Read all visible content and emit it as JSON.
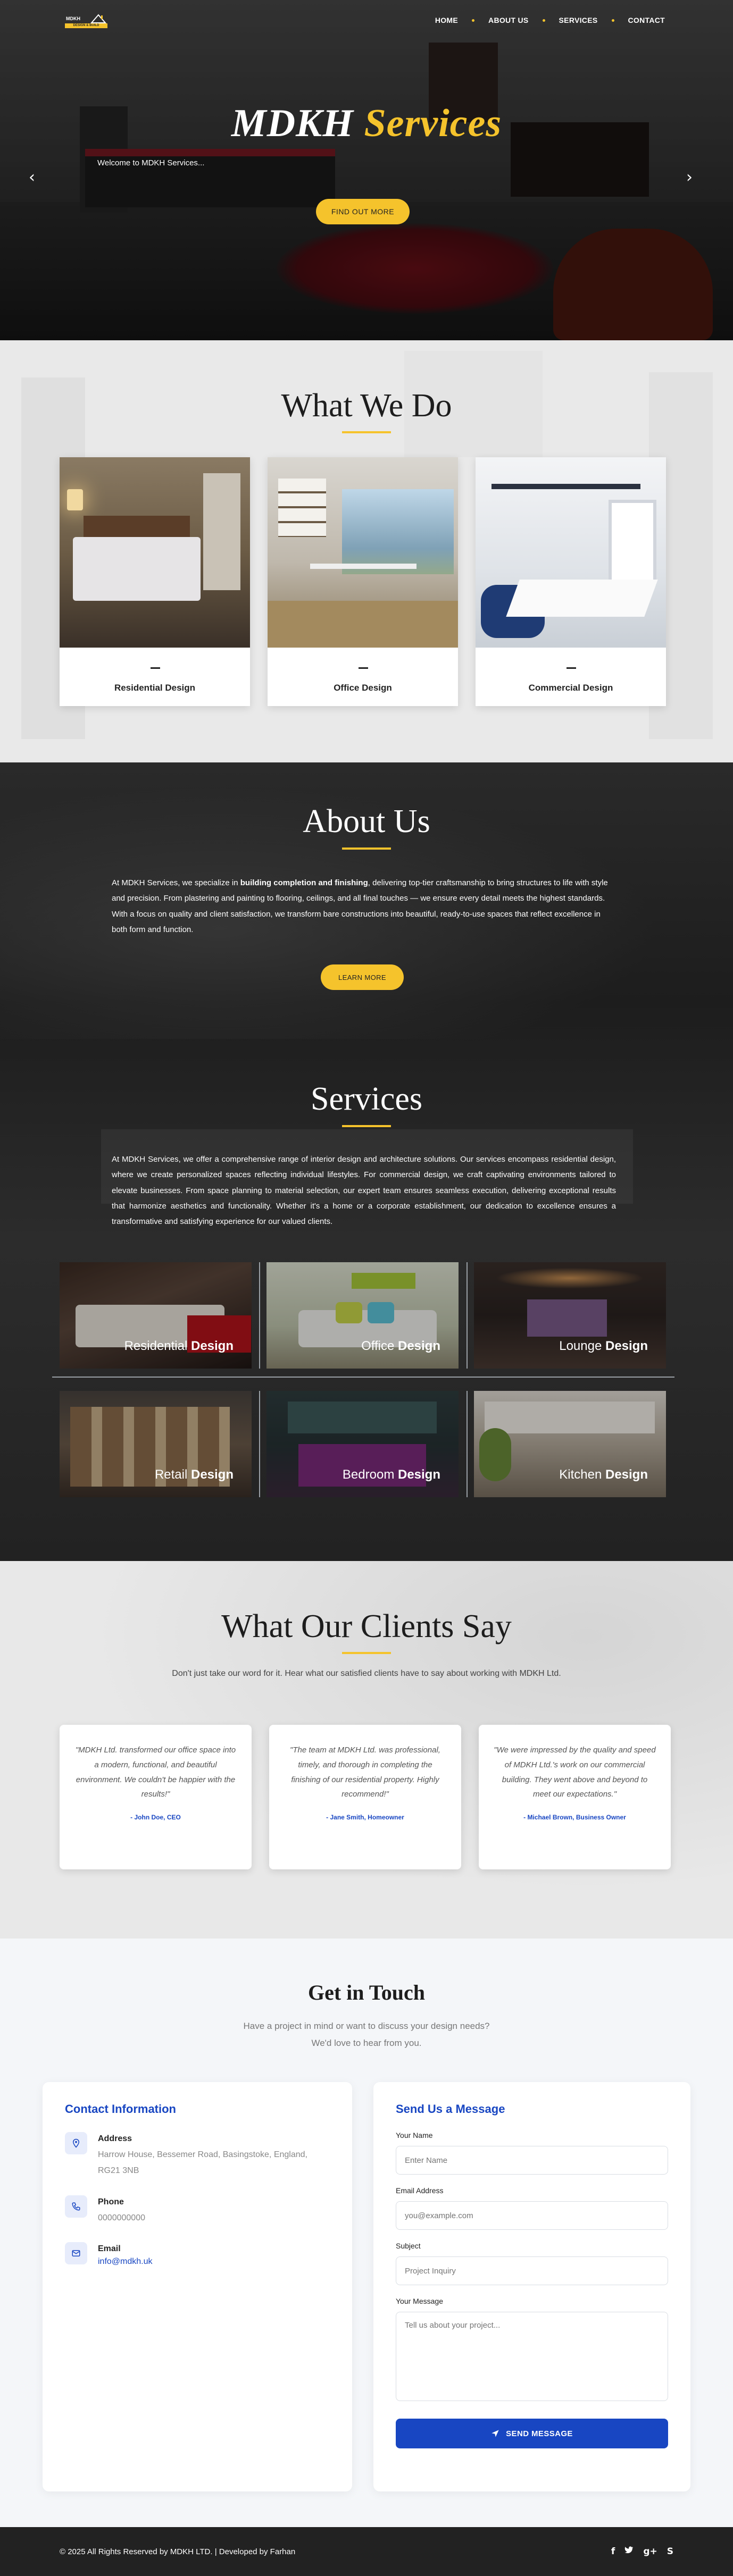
{
  "header": {
    "logo_text": "MDKH",
    "logo_tagline": "DESIGN & BUILD",
    "nav": [
      "HOME",
      "ABOUT US",
      "SERVICES",
      "CONTACT"
    ]
  },
  "hero": {
    "title_main": "MDKH",
    "title_accent": "Services",
    "welcome": "Welcome to MDKH Services...",
    "button": "FIND OUT MORE",
    "prev_icon": "chevron-left-icon",
    "next_icon": "chevron-right-icon"
  },
  "what_we_do": {
    "title": "What We Do",
    "cards": [
      {
        "label": "Residential Design"
      },
      {
        "label": "Office Design"
      },
      {
        "label": "Commercial Design"
      }
    ]
  },
  "about": {
    "title": "About Us",
    "text_before": "At MDKH Services, we specialize in ",
    "text_bold": "building completion and finishing",
    "text_after": ", delivering top-tier craftsmanship to bring structures to life with style and precision. From plastering and painting to flooring, ceilings, and all final touches — we ensure every detail meets the highest standards. With a focus on quality and client satisfaction, we transform bare constructions into beautiful, ready-to-use spaces that reflect excellence in both form and function.",
    "button": "LEARN MORE"
  },
  "services": {
    "title": "Services",
    "text": "At MDKH Services, we offer a comprehensive range of interior design and architecture solutions. Our services encompass residential design, where we create personalized spaces reflecting individual lifestyles. For commercial design, we craft captivating environments tailored to elevate businesses. From space planning to material selection, our expert team ensures seamless execution, delivering exceptional results that harmonize aesthetics and functionality. Whether it's a home or a corporate establishment, our dedication to excellence ensures a transformative and satisfying experience for our valued clients.",
    "tiles": [
      {
        "word": "Residential",
        "bold": "Design"
      },
      {
        "word": "Office",
        "bold": "Design"
      },
      {
        "word": "Lounge",
        "bold": "Design"
      },
      {
        "word": "Retail",
        "bold": "Design"
      },
      {
        "word": "Bedroom",
        "bold": "Design"
      },
      {
        "word": "Kitchen",
        "bold": "Design"
      }
    ]
  },
  "testimonials": {
    "title": "What Our Clients Say",
    "subtitle": "Don't just take our word for it. Hear what our satisfied clients have to say about working with MDKH Ltd.",
    "items": [
      {
        "quote": "\"MDKH Ltd. transformed our office space into a modern, functional, and beautiful environment. We couldn't be happier with the results!\"",
        "author": "- John Doe, CEO"
      },
      {
        "quote": "\"The team at MDKH Ltd. was professional, timely, and thorough in completing the finishing of our residential property. Highly recommend!\"",
        "author": "- Jane Smith, Homeowner"
      },
      {
        "quote": "\"We were impressed by the quality and speed of MDKH Ltd.'s work on our commercial building. They went above and beyond to meet our expectations.\"",
        "author": "- Michael Brown, Business Owner"
      }
    ]
  },
  "contact": {
    "title": "Get in Touch",
    "subtitle_1": "Have a project in mind or want to discuss your design needs?",
    "subtitle_2": "We'd love to hear from you.",
    "info_title": "Contact Information",
    "address_label": "Address",
    "address": "Harrow House, Bessemer Road, Basingstoke, England, RG21 3NB",
    "phone_label": "Phone",
    "phone": "0000000000",
    "email_label": "Email",
    "email": "info@mdkh.uk",
    "form_title": "Send Us a Message",
    "name_label": "Your Name",
    "name_placeholder": "Enter Name",
    "email_field_label": "Email Address",
    "email_placeholder": "you@example.com",
    "subject_label": "Subject",
    "subject_placeholder": "Project Inquiry",
    "message_label": "Your Message",
    "message_placeholder": "Tell us about your project...",
    "send_button": "SEND MESSAGE"
  },
  "footer": {
    "copyright": "© 2025 All Rights Reserved by MDKH LTD. | Developed by Farhan",
    "social": [
      "facebook-icon",
      "twitter-icon",
      "google-plus-icon",
      "skype-icon"
    ]
  },
  "colors": {
    "accent": "#f5c32c",
    "primary_blue": "#1846c2",
    "dark": "#222222"
  }
}
